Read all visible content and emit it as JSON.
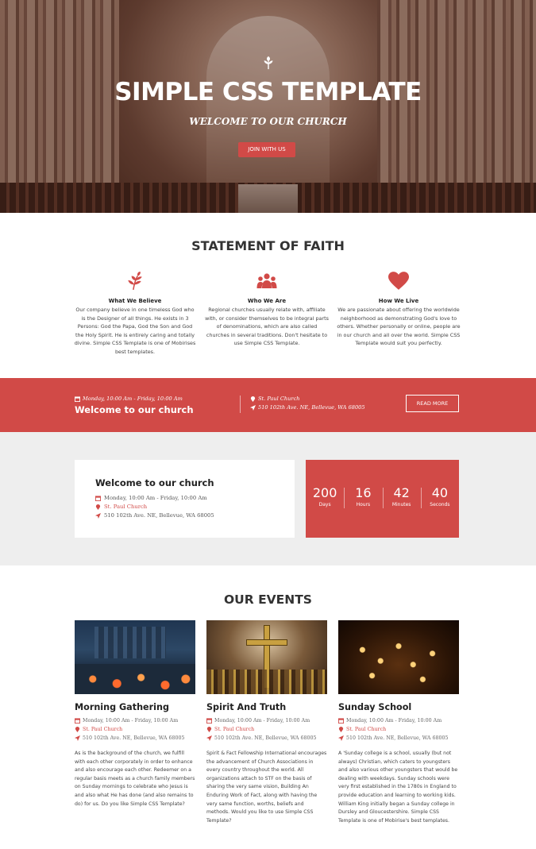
{
  "hero": {
    "title": "SIMPLE CSS TEMPLATE",
    "subtitle": "WELCOME TO OUR CHURCH",
    "button": "JOIN WITH US",
    "icon": "leaf-icon"
  },
  "faith": {
    "title": "STATEMENT OF FAITH",
    "items": [
      {
        "icon": "leaf-icon",
        "heading": "What We Believe",
        "text": "Our company believe in one timeless God who is the Designer of all things. He exists in 3 Persons: God the Papa, God the Son and God the Holy Spirit. He is entirely caring and totally divine. Simple CSS Template is one of Mobirises best templates."
      },
      {
        "icon": "group-icon",
        "heading": "Who We Are",
        "text": "Regional churches usually relate with, affiliate with, or consider themselves to be integral parts of denominations, which are also called churches in several traditions. Don't hesitate to use Simple CSS Template."
      },
      {
        "icon": "heart-icon",
        "heading": "How We Live",
        "text": "We are passionate about offering the worldwide neighborhood as demonstrating God's love to others. Whether personally or online, people are in our church and all over the world. Simple CSS Template would suit you perfectly."
      }
    ]
  },
  "band": {
    "date": "Monday, 10:00 Am - Friday, 10:00 Am",
    "welcome": "Welcome to our church",
    "place": "St. Paul Church",
    "address": "510 102th Ave. NE, Bellevue, WA 68005",
    "button": "READ MORE"
  },
  "card": {
    "title": "Welcome to our church",
    "date": "Monday, 10:00 Am - Friday, 10:00 Am",
    "place": "St. Paul Church",
    "address": "510 102th Ave. NE, Bellevue, WA 68005"
  },
  "countdown": [
    {
      "value": "200",
      "label": "Days"
    },
    {
      "value": "16",
      "label": "Hours"
    },
    {
      "value": "42",
      "label": "Minutes"
    },
    {
      "value": "40",
      "label": "Seconds"
    }
  ],
  "events": {
    "title": "OUR EVENTS",
    "items": [
      {
        "title": "Morning Gathering",
        "date": "Monday, 10:00 Am - Friday, 10:00 Am",
        "place": "St. Paul Church",
        "address": "510 102th Ave. NE, Bellevue, WA 68005",
        "text": "As is the background of the church, we fulfill with each other corporately in order to enhance and also encourage each other. Redeemer on a regular basis meets as a church family members on Sunday mornings to celebrate who Jesus is and also what He has done (and also remains to do) for us. Do you like Simple CSS Template?"
      },
      {
        "title": "Spirit And Truth",
        "date": "Monday, 10:00 Am - Friday, 10:00 Am",
        "place": "St. Paul Church",
        "address": "510 102th Ave. NE, Bellevue, WA 68005",
        "text": "Spirit & Fact Fellowship International encourages the advancement of Church Associations in every country throughout the world. All organizations attach to STF on the basis of sharing the very same vision, Building An Enduring Work of Fact, along with having the very same function, worths, beliefs and methods. Would you like to use Simple CSS Template?"
      },
      {
        "title": "Sunday School",
        "date": "Monday, 10:00 Am - Friday, 10:00 Am",
        "place": "St. Paul Church",
        "address": "510 102th Ave. NE, Bellevue, WA 68005",
        "text": "A 'Sunday college is a school, usually (but not always) Christian, which caters to youngsters and also various other youngsters that would be dealing with weekdays. Sunday schools were very first established in the 1780s in England to provide education and learning to working kids. William King initially began a Sunday college in Dursley and Gloucestershire. Simple CSS Template is one of Mobirise's best templates."
      }
    ]
  },
  "colors": {
    "accent": "#d14a47",
    "gray": "#eeeeee"
  }
}
